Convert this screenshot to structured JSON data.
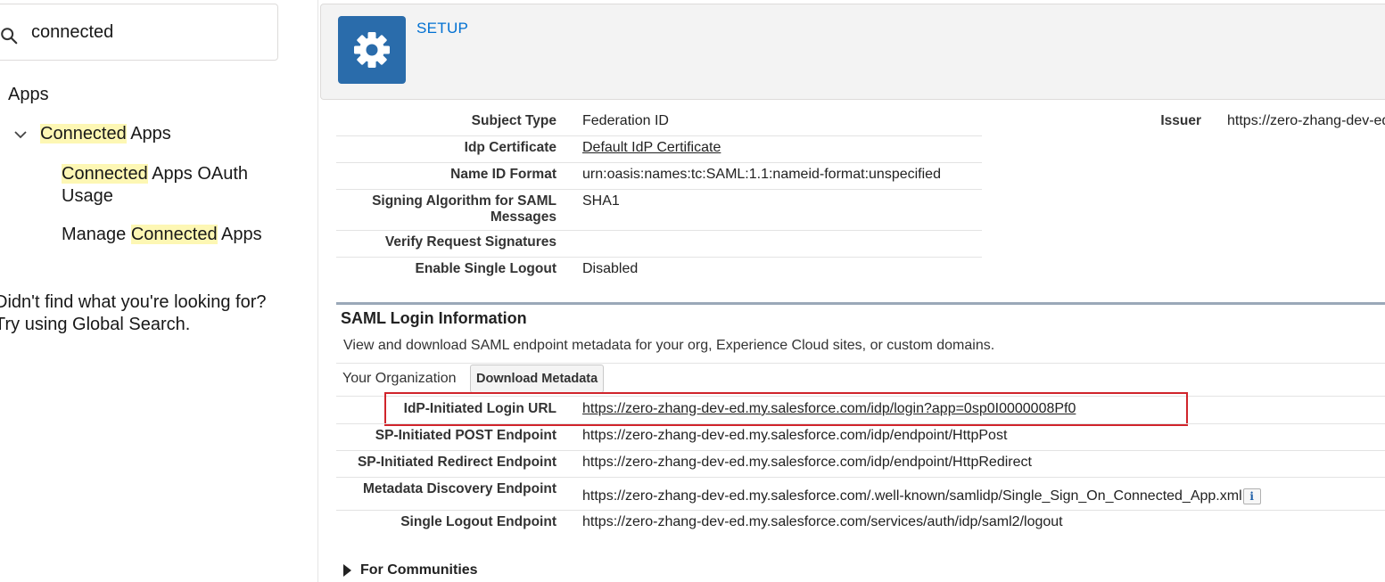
{
  "search": {
    "value": "connected"
  },
  "tree": {
    "apps": "Apps",
    "connected_apps_hl": "Connected",
    "connected_apps_rest": " Apps",
    "child1_hl": "Connected",
    "child1_rest": " Apps OAuth Usage",
    "child2_pre": "Manage ",
    "child2_hl": "Connected",
    "child2_rest": " Apps"
  },
  "not_found": {
    "line1": "Didn't find what you're looking for?",
    "line2": "Try using Global Search."
  },
  "header": {
    "setup_label": "SETUP"
  },
  "details": {
    "subject_type_label": "Subject Type",
    "subject_type_value": "Federation ID",
    "issuer_label": "Issuer",
    "issuer_value": "https://zero-zhang-dev-ed",
    "idp_cert_label": "Idp Certificate",
    "idp_cert_value": "Default IdP Certificate",
    "name_id_label": "Name ID Format",
    "name_id_value": "urn:oasis:names:tc:SAML:1.1:nameid-format:unspecified",
    "signing_label": "Signing Algorithm for SAML Messages",
    "signing_value": "SHA1",
    "verify_label": "Verify Request Signatures",
    "verify_value": "",
    "slo_label": "Enable Single Logout",
    "slo_value": "Disabled"
  },
  "saml": {
    "title": "SAML Login Information",
    "description": "View and download SAML endpoint metadata for your org, Experience Cloud sites, or custom domains.",
    "org_label": "Your Organization",
    "download_button": "Download Metadata",
    "rows": [
      {
        "label": "IdP-Initiated Login URL",
        "value": "https://zero-zhang-dev-ed.my.salesforce.com/idp/login?app=0sp0I0000008Pf0"
      },
      {
        "label": "SP-Initiated POST Endpoint",
        "value": "https://zero-zhang-dev-ed.my.salesforce.com/idp/endpoint/HttpPost"
      },
      {
        "label": "SP-Initiated Redirect Endpoint",
        "value": "https://zero-zhang-dev-ed.my.salesforce.com/idp/endpoint/HttpRedirect"
      },
      {
        "label": "Metadata Discovery Endpoint",
        "value": "https://zero-zhang-dev-ed.my.salesforce.com/.well-known/samlidp/Single_Sign_On_Connected_App.xml"
      },
      {
        "label": "Single Logout Endpoint",
        "value": "https://zero-zhang-dev-ed.my.salesforce.com/services/auth/idp/saml2/logout"
      }
    ],
    "info_glyph": "i"
  },
  "communities": {
    "label": "For Communities"
  }
}
